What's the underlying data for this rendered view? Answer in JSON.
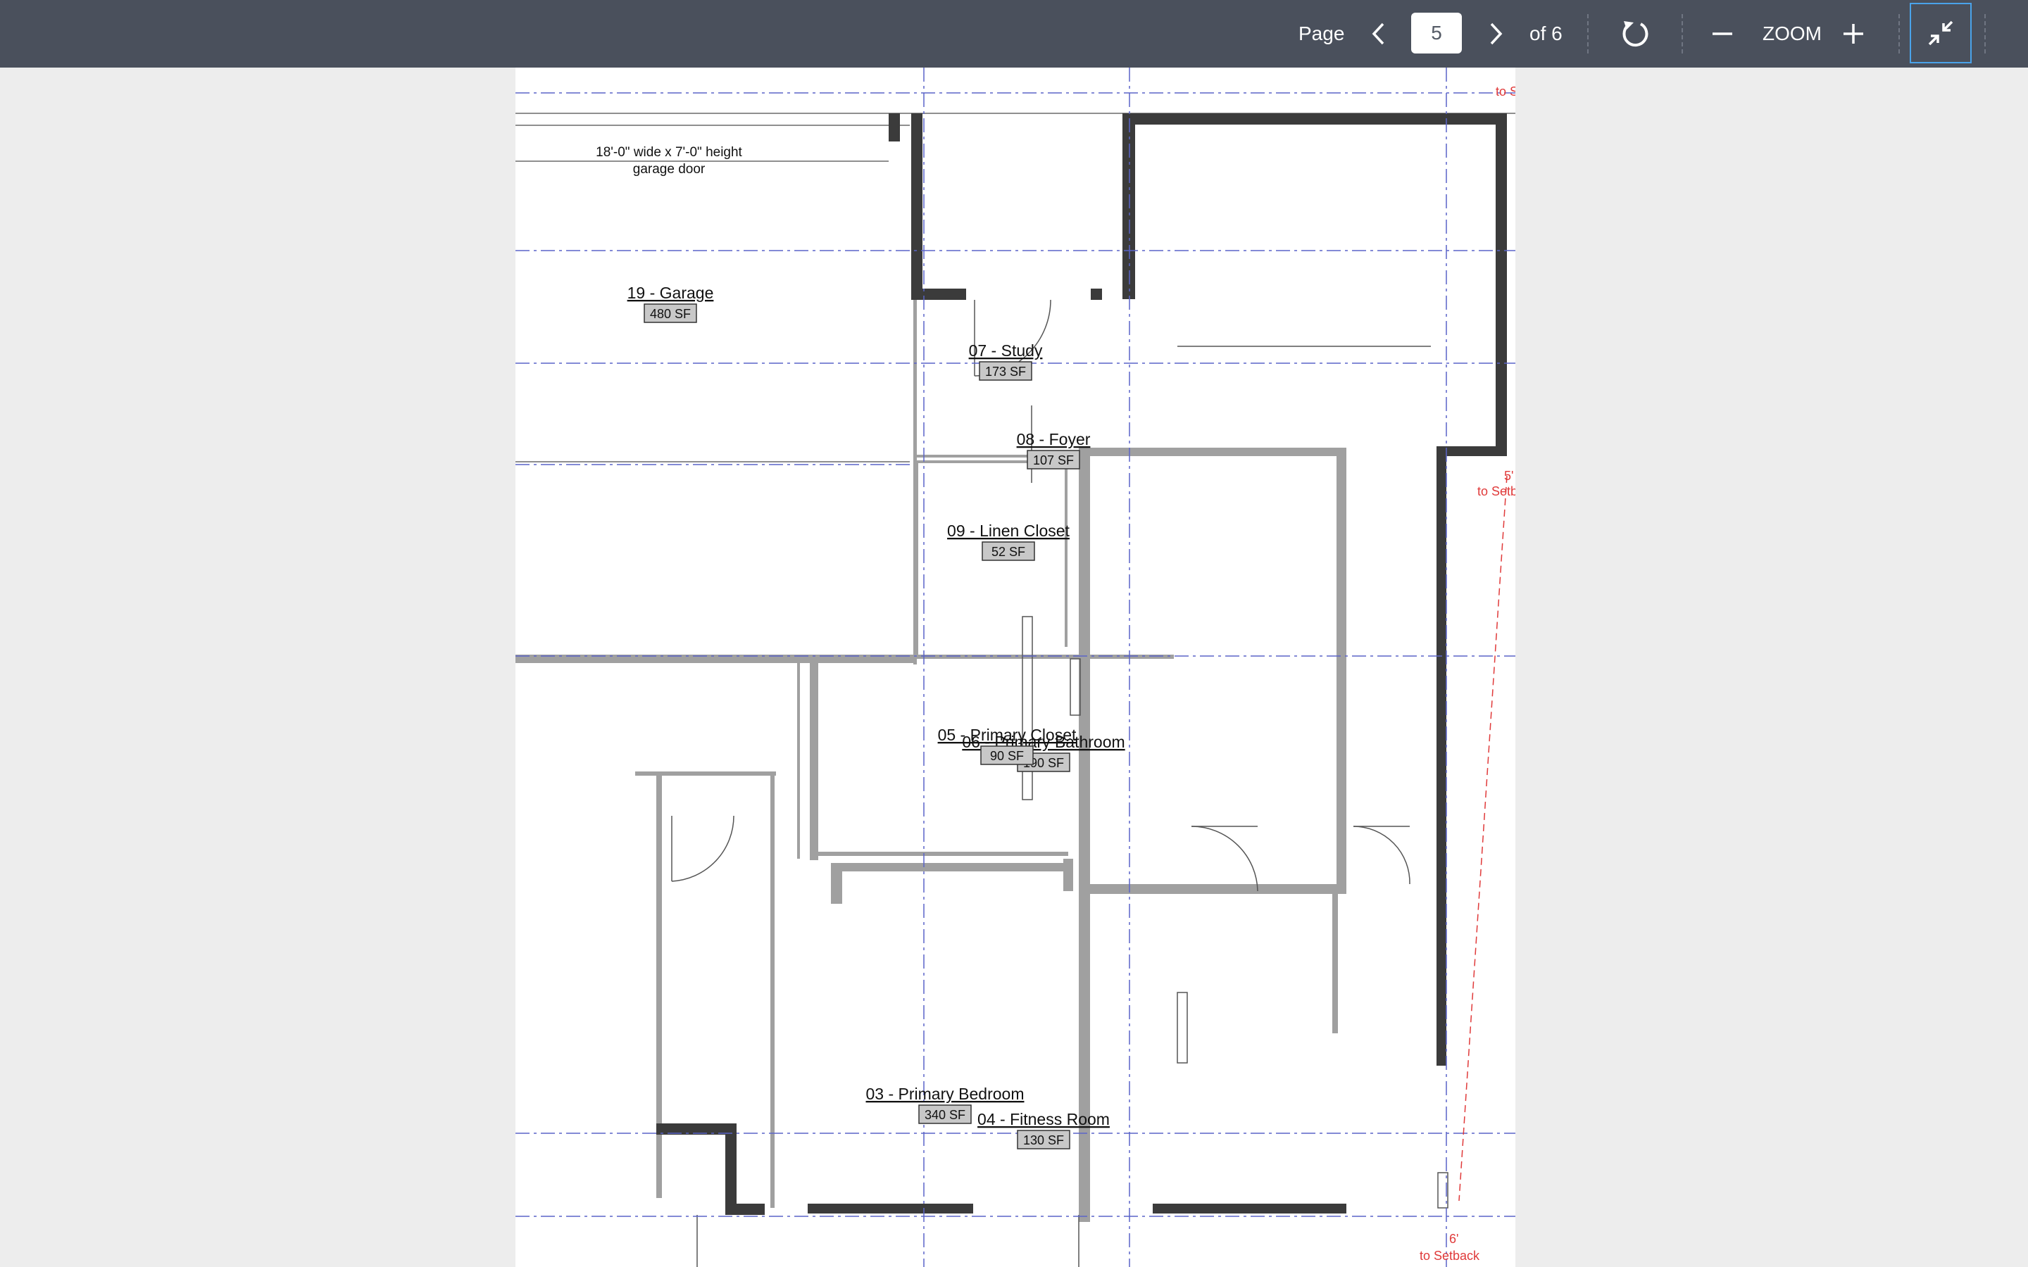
{
  "toolbar": {
    "page_label": "Page",
    "current_page": "5",
    "of_label": "of 6",
    "zoom_label": "ZOOM",
    "icons": {
      "prev": "chevron-left-icon",
      "next": "chevron-right-icon",
      "rotate": "rotate-icon",
      "zoom_out": "minus-icon",
      "zoom_in": "plus-icon",
      "collapse": "collapse-icon"
    },
    "colors": {
      "bar": "#4a505c",
      "focus": "#4aa3ea"
    }
  },
  "plan": {
    "rooms": [
      {
        "name": "19 - Garage",
        "area": "480 SF"
      },
      {
        "name": "07 - Study",
        "area": "173 SF"
      },
      {
        "name": "08 - Foyer",
        "area": "107 SF"
      },
      {
        "name": "09 - Linen Closet",
        "area": "52 SF"
      },
      {
        "name": "06 - Primary Bathroom",
        "area": "190 SF"
      },
      {
        "name": "05 - Primary Closet",
        "area": "90 SF"
      },
      {
        "name": "03 - Primary Bedroom",
        "area": "340 SF"
      },
      {
        "name": "04 - Fitness Room",
        "area": "130 SF"
      }
    ],
    "garage_door_note": [
      "18'-0\" wide x 7'-0\" height",
      "garage door"
    ],
    "setback_labels": [
      {
        "lines": [
          "to S"
        ]
      },
      {
        "lines": [
          "5'",
          "to Setb"
        ]
      },
      {
        "lines": [
          "6'",
          "to Setback"
        ]
      }
    ],
    "colors": {
      "wall_dark": "#3b3b3b",
      "wall_light": "#9a9a9a",
      "gridline": "#5a64c8",
      "setback": "#e03a3a",
      "area_tag": "#c8c8c8"
    }
  }
}
